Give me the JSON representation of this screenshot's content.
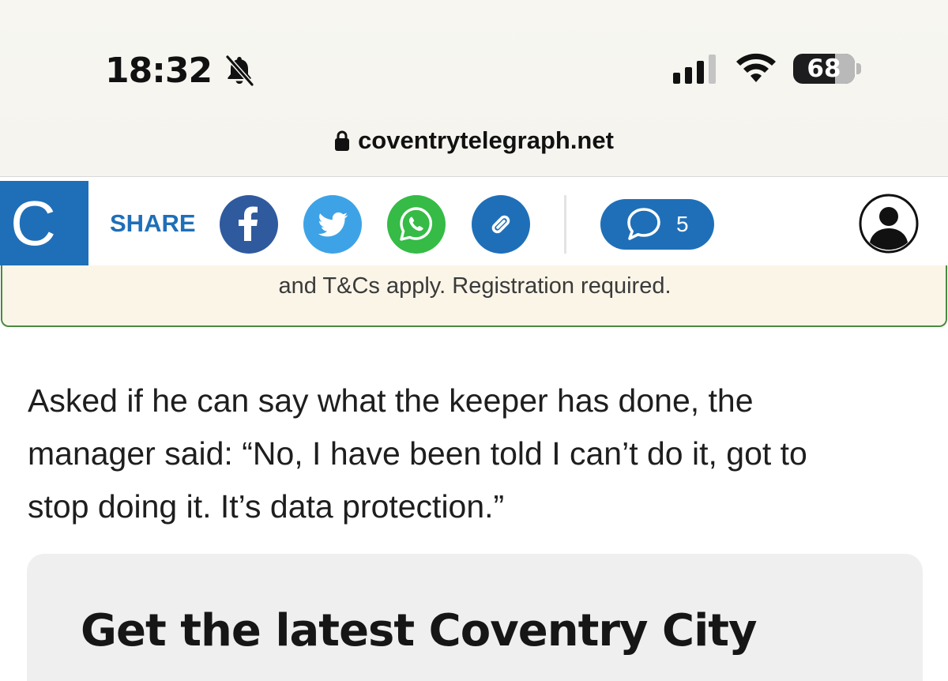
{
  "status_bar": {
    "time": "18:32",
    "battery_level": "68",
    "icons": [
      "bell-slash-icon",
      "cellular-signal-icon",
      "wifi-icon",
      "battery-icon"
    ]
  },
  "address_bar": {
    "domain": "coventrytelegraph.net",
    "icon": "lock-icon"
  },
  "toolbar": {
    "logo_letter": "C",
    "share_label": "SHARE",
    "share_buttons": [
      "facebook-icon",
      "twitter-icon",
      "whatsapp-icon",
      "link-icon"
    ],
    "comment_count": "5",
    "colors": {
      "brand": "#1f6fb8",
      "facebook": "#2f5a9e",
      "twitter": "#3ea3e6",
      "whatsapp": "#35bb46"
    }
  },
  "promo": {
    "text": "and T&Cs apply. Registration required."
  },
  "article": {
    "paragraph_lines": [
      "Asked if he can say what the keeper has done, the",
      "manager said: “No, I have been told I can’t do it, got to",
      "stop doing it. It’s data protection.”"
    ]
  },
  "newsletter_card": {
    "title": "Get the latest Coventry City"
  }
}
